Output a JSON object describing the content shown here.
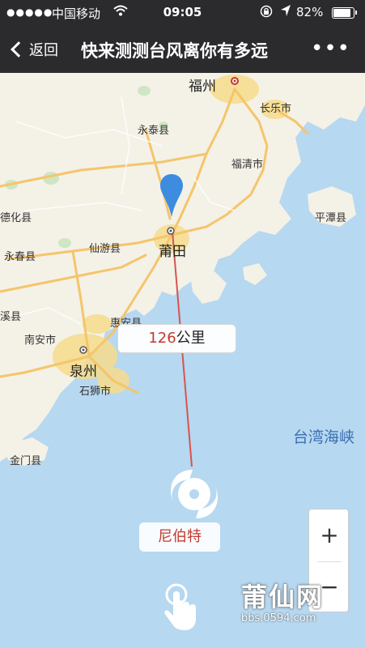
{
  "status_bar": {
    "signal": "●●●●●",
    "carrier": "中国移动",
    "wifi": "wifi-icon",
    "time": "09:05",
    "lock": "rotation-lock-icon",
    "location": "location-arrow-icon",
    "battery": "82%",
    "battery_level": 0.82
  },
  "nav": {
    "back_label": "返回",
    "title": "快来测测台风离你有多远",
    "more": "•••"
  },
  "map": {
    "cities": {
      "fuzhou": "福州",
      "changle": "长乐市",
      "yongtai": "永泰县",
      "fuqing": "福清市",
      "pingtan": "平潭县",
      "dehua": "德化县",
      "putian": "莆田",
      "yongchun": "永春县",
      "xianyou": "仙游县",
      "anxi": "溪县",
      "nanan": "南安市",
      "huian": "惠安县",
      "quanzhou": "泉州",
      "shishi": "石狮市",
      "jinmen": "金门县"
    },
    "strait": "台湾海峡",
    "distance_value": "126",
    "distance_unit": "公里",
    "typhoon_name": "尼伯特",
    "colors": {
      "line": "#d9534f",
      "pin": "#3d8ce0",
      "land": "#f4f1e7",
      "sea": "#b6d8f0",
      "road": "#f5c56b"
    }
  },
  "zoom": {
    "in": "+",
    "out": "−"
  },
  "watermark": {
    "logo": "莆仙网",
    "url": "bbs.0594.com"
  }
}
